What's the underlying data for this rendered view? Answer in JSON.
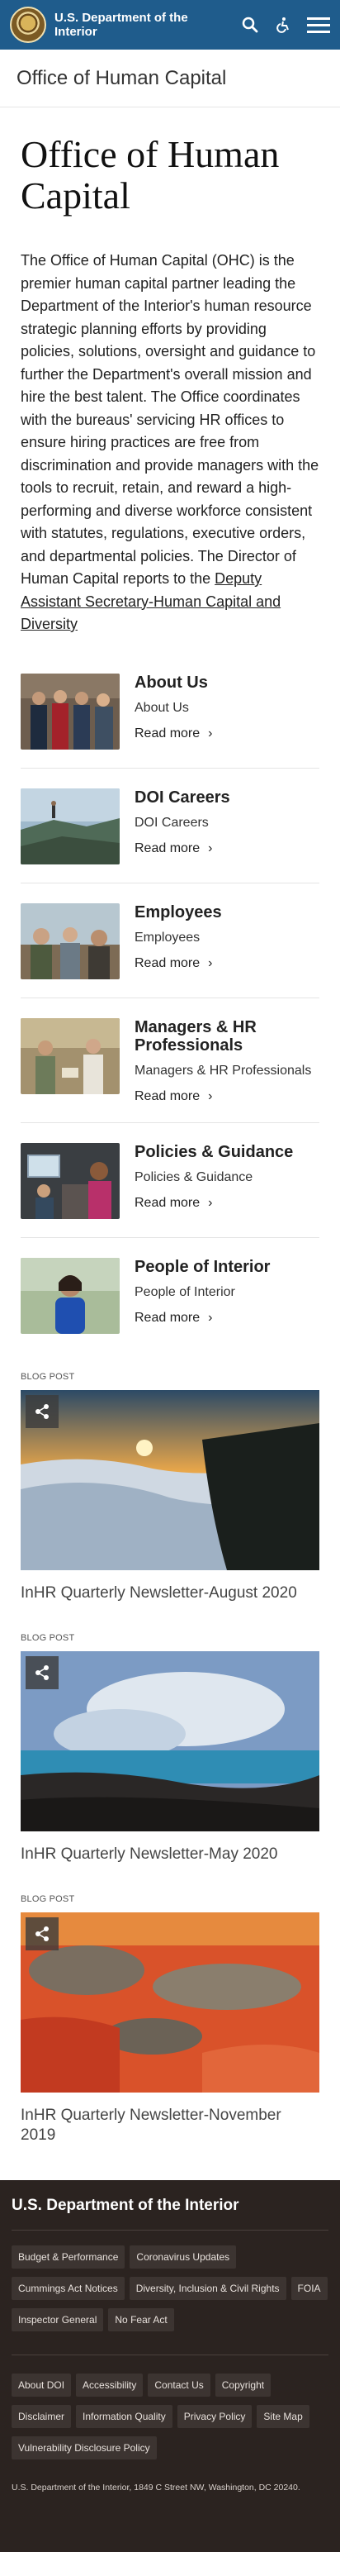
{
  "header": {
    "agency_name": "U.S. Department of the Interior",
    "icons": [
      "search-icon",
      "accessibility-icon",
      "menu-icon"
    ]
  },
  "subsite": {
    "title": "Office of Human Capital"
  },
  "main": {
    "title": "Office of Human Capital",
    "intro_text": "The Office of Human Capital (OHC) is the premier human capital partner leading the Department of the Interior's human resource strategic planning efforts by providing policies, solutions, oversight and guidance to further the Department's overall mission and hire the best talent. The Office coordinates with the bureaus' servicing HR offices to ensure hiring practices are free from discrimination and provide managers with the tools to recruit, retain, and reward a high-performing and diverse workforce consistent with statutes, regulations, executive orders, and departmental policies. The Director of Human Capital reports to the ",
    "intro_link": "Deputy Assistant Secretary-Human Capital and Diversity"
  },
  "cards": [
    {
      "title": "About Us",
      "subtitle": "About Us",
      "more": "Read more"
    },
    {
      "title": "DOI Careers",
      "subtitle": "DOI Careers",
      "more": "Read more"
    },
    {
      "title": "Employees",
      "subtitle": "Employees",
      "more": "Read more"
    },
    {
      "title": "Managers & HR Professionals",
      "subtitle": "Managers & HR Professionals",
      "more": "Read more"
    },
    {
      "title": "Policies & Guidance",
      "subtitle": "Policies & Guidance",
      "more": "Read more"
    },
    {
      "title": "People of Interior",
      "subtitle": "People of Interior",
      "more": "Read more"
    }
  ],
  "blogs": [
    {
      "label": "BLOG POST",
      "title": "InHR Quarterly Newsletter-August 2020"
    },
    {
      "label": "BLOG POST",
      "title": "InHR Quarterly Newsletter-May 2020"
    },
    {
      "label": "BLOG POST",
      "title": "InHR Quarterly Newsletter-November 2019"
    }
  ],
  "footer": {
    "title": "U.S. Department of the Interior",
    "primary_links": [
      "Budget & Performance",
      "Coronavirus Updates",
      "Cummings Act Notices",
      "Diversity, Inclusion & Civil Rights",
      "FOIA",
      "Inspector General",
      "No Fear Act"
    ],
    "secondary_links": [
      "About DOI",
      "Accessibility",
      "Contact Us",
      "Copyright",
      "Disclaimer",
      "Information Quality",
      "Privacy Policy",
      "Site Map",
      "Vulnerability Disclosure Policy"
    ],
    "address": "U.S. Department of the Interior, 1849 C Street NW, Washington, DC 20240."
  },
  "colors": {
    "header": "#1f5c8c",
    "footer": "#2b2320"
  }
}
